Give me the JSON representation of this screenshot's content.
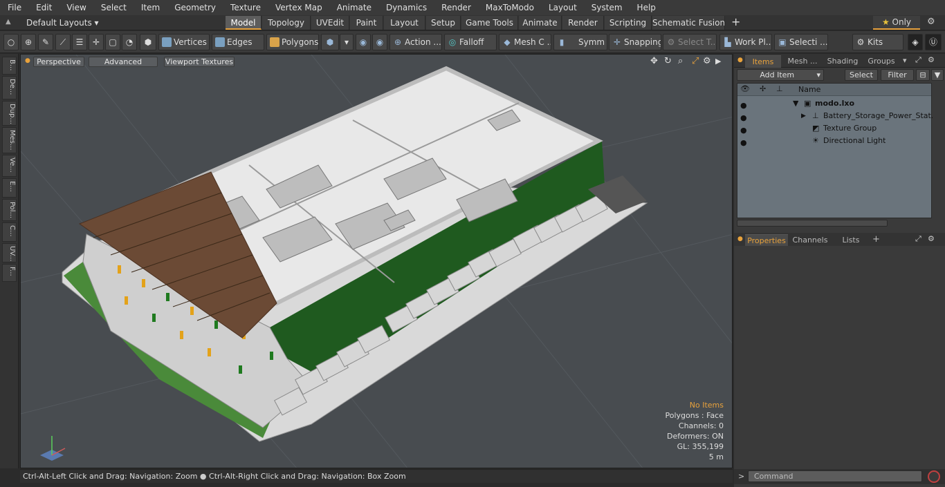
{
  "menubar": {
    "items": [
      "File",
      "Edit",
      "View",
      "Select",
      "Item",
      "Geometry",
      "Texture",
      "Vertex Map",
      "Animate",
      "Dynamics",
      "Render",
      "MaxToModo",
      "Layout",
      "System",
      "Help"
    ]
  },
  "layoutbar": {
    "layouts_label": "Default Layouts",
    "tabs": [
      "Model",
      "Topology",
      "UVEdit",
      "Paint",
      "Layout",
      "Setup",
      "Game Tools",
      "Animate",
      "Render",
      "Scripting",
      "Schematic Fusion"
    ],
    "active_tab": "Model",
    "add": "+",
    "only_label": "Only"
  },
  "toolbar": {
    "vertices": "Vertices",
    "edges": "Edges",
    "polygons": "Polygons",
    "action": "Action",
    "falloff": "Falloff",
    "mesh": "Mesh C ...",
    "symm": "Symm ...",
    "snapping": "Snapping",
    "select_t": "Select T...",
    "workpl": "Work Pl...",
    "selecti": "Selecti ...",
    "kits": "Kits"
  },
  "leftstrip": {
    "tabs": [
      "B...",
      "De...",
      "Dup...",
      "Mes...",
      "Ve...",
      "E...",
      "Pol...",
      "C...",
      "UV...",
      "F..."
    ]
  },
  "viewport": {
    "perspective": "Perspective",
    "advanced": "Advanced",
    "viewport_textures": "Viewport Textures",
    "stats": {
      "no_items": "No Items",
      "polygons": "Polygons : Face",
      "channels": "Channels: 0",
      "deformers": "Deformers: ON",
      "gl": "GL: 355,199",
      "scale": "5 m"
    }
  },
  "status": {
    "left": "Ctrl-Alt-Left Click and Drag: Navigation: Zoom",
    "right": "Ctrl-Alt-Right Click and Drag: Navigation: Box Zoom"
  },
  "items_panel": {
    "tabs": [
      "Items",
      "Mesh ...",
      "Shading",
      "Groups"
    ],
    "active_tab": "Items",
    "add_item": "Add Item",
    "select": "Select",
    "filter": "Filter",
    "col_name": "Name",
    "tree": [
      {
        "label": "modo.lxo",
        "level": 0
      },
      {
        "label": "Battery_Storage_Power_Stat...",
        "level": 1
      },
      {
        "label": "Texture Group",
        "level": 1
      },
      {
        "label": "Directional Light",
        "level": 1
      }
    ]
  },
  "props_panel": {
    "tabs": [
      "Properties",
      "Channels",
      "Lists"
    ],
    "active_tab": "Properties",
    "add": "+"
  },
  "command": {
    "prompt": ">",
    "placeholder": "Command"
  },
  "colors": {
    "accent": "#e8a23c",
    "viewport_bg": "#484c50",
    "roof": "#e4e4e4",
    "green_wall": "#1f5a1f",
    "pergola": "#6b4a35",
    "grass": "#4a8a3a"
  }
}
